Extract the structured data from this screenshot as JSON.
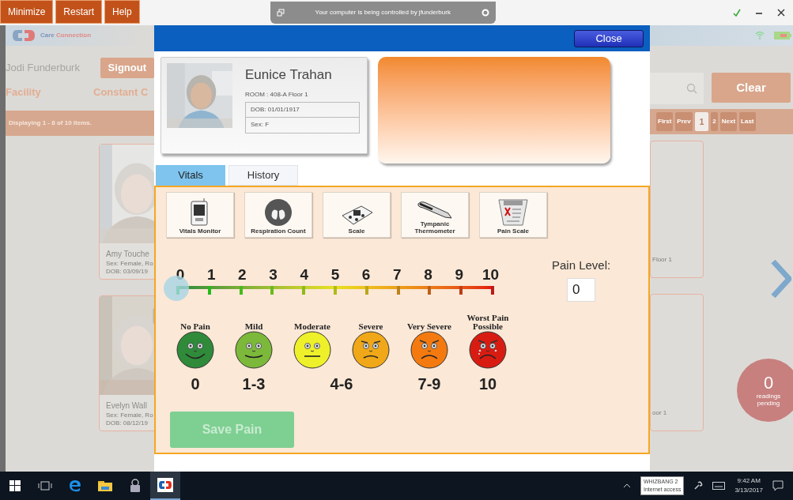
{
  "top_bar": {
    "buttons": [
      "Minimize",
      "Restart",
      "Help"
    ],
    "notification": "Your computer is being controlled by jfunderburk"
  },
  "app_header": {
    "logo_words": [
      "Care",
      "Connection"
    ]
  },
  "user": {
    "name": "Jodi Funderburk",
    "signout": "Signout"
  },
  "filters": [
    "Facility",
    "Constant C"
  ],
  "search": {
    "clear": "Clear"
  },
  "pagination": {
    "summary": "Displaying 1 - 8 of 10 items.",
    "pages": [
      {
        "label": "First",
        "selected": false
      },
      {
        "label": "Prev",
        "selected": false
      },
      {
        "label": "1",
        "selected": true
      },
      {
        "label": "2",
        "selected": false
      },
      {
        "label": "Next",
        "selected": false
      },
      {
        "label": "Last",
        "selected": false
      }
    ]
  },
  "left_cards": [
    {
      "name": "Amy Touche",
      "lines": [
        "Sex: Female, Ro",
        "DOB: 03/09/19"
      ]
    },
    {
      "name": "Evelyn Wall",
      "lines": [
        "Sex: Female, Ro",
        "DOB: 08/12/19"
      ]
    }
  ],
  "right_cards": [
    {
      "lines": [
        "Floor 1"
      ]
    },
    {
      "lines": [
        "oor 1"
      ]
    }
  ],
  "pending": {
    "count": "0",
    "label": "readings pending"
  },
  "modal": {
    "close": "Close",
    "patient": {
      "name": "Eunice Trahan",
      "room": "ROOM : 408-A Floor 1",
      "dob": "DOB: 01/01/1917",
      "sex": "Sex: F"
    },
    "tabs": [
      {
        "label": "Vitals",
        "selected": true
      },
      {
        "label": "History",
        "selected": false
      }
    ],
    "tools": [
      {
        "kind": "monitor",
        "label": "Vitals Monitor"
      },
      {
        "kind": "lungs",
        "label": "Respiration Count"
      },
      {
        "kind": "scale",
        "label": "Scale"
      },
      {
        "kind": "thermometer",
        "label": "Tympanic Thermometer"
      },
      {
        "kind": "pain",
        "label": "Pain Scale"
      }
    ],
    "scale": {
      "ticks": [
        "0",
        "1",
        "2",
        "3",
        "4",
        "5",
        "6",
        "7",
        "8",
        "9",
        "10"
      ],
      "level": 0
    },
    "pain_level": {
      "label": "Pain Level:",
      "value": "0"
    },
    "faces": [
      {
        "label": "No Pain",
        "kind": "grin",
        "color": "#2f8a3a"
      },
      {
        "label": "Mild",
        "kind": "smile",
        "color": "#7cb83a"
      },
      {
        "label": "Moderate",
        "kind": "flat",
        "color": "#eef02a"
      },
      {
        "label": "Severe",
        "kind": "frown",
        "color": "#f0a818"
      },
      {
        "label": "Very Severe",
        "kind": "sad",
        "color": "#f47a10"
      },
      {
        "label": "Worst Pain Possible",
        "kind": "cry",
        "color": "#d81c12"
      }
    ],
    "ranges": [
      "0",
      "1-3",
      "4-6",
      "7-9",
      "10"
    ],
    "save": {
      "label": "Save Pain",
      "disabled": true
    }
  },
  "taskbar": {
    "apps": [
      {
        "kind": "windows",
        "selected": false
      },
      {
        "kind": "taskview",
        "selected": false
      },
      {
        "kind": "browser",
        "selected": false
      },
      {
        "kind": "folder",
        "selected": false
      },
      {
        "kind": "lock",
        "selected": false
      },
      {
        "kind": "app",
        "selected": true
      }
    ],
    "network_name": "WHIZBANG 2",
    "network_status": "Internet access",
    "time": "9:42 AM",
    "date": "3/13/2017"
  }
}
